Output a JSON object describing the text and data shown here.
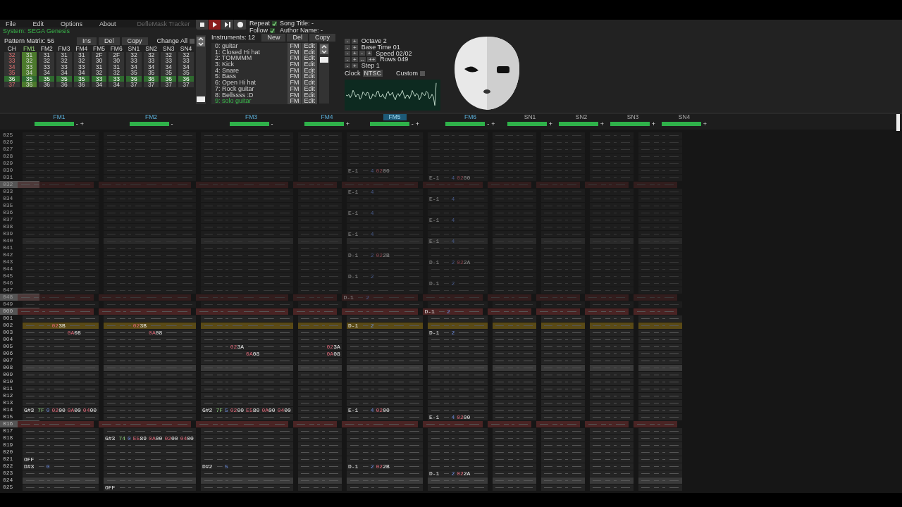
{
  "menu": [
    "File",
    "Edit",
    "Options",
    "About"
  ],
  "app_title": "DefleMask Tracker",
  "transport": [
    {
      "kind": "stop",
      "active": false
    },
    {
      "kind": "play",
      "active": true
    },
    {
      "kind": "step",
      "active": false
    },
    {
      "kind": "record",
      "active": false
    }
  ],
  "toggles": [
    {
      "label": "Repeat",
      "checked": true
    },
    {
      "label": "Follow",
      "checked": true
    }
  ],
  "song": {
    "title": "Song Title: -",
    "author": "Author Name: -"
  },
  "system": "System: SEGA Genesis",
  "pattern_matrix": {
    "label": "Pattern Matrix: 56",
    "buttons": [
      "Ins",
      "Del",
      "Copy"
    ],
    "change_all": {
      "label": "Change All",
      "checked": false
    },
    "columns": [
      {
        "label": "CH",
        "selected": false
      },
      {
        "label": "FM1",
        "selected": true
      },
      {
        "label": "FM2",
        "selected": false
      },
      {
        "label": "FM3",
        "selected": false
      },
      {
        "label": "FM4",
        "selected": false
      },
      {
        "label": "FM5",
        "selected": false
      },
      {
        "label": "FM6",
        "selected": false
      },
      {
        "label": "SN1",
        "selected": false
      },
      {
        "label": "SN2",
        "selected": false
      },
      {
        "label": "SN3",
        "selected": false
      },
      {
        "label": "SN4",
        "selected": false
      }
    ],
    "rows": [
      {
        "selected": false,
        "cells": [
          "32",
          "31",
          "31",
          "31",
          "31",
          "2F",
          "2F",
          "32",
          "32",
          "32",
          "32"
        ]
      },
      {
        "selected": false,
        "cells": [
          "33",
          "32",
          "32",
          "32",
          "32",
          "30",
          "30",
          "33",
          "33",
          "33",
          "33"
        ]
      },
      {
        "selected": false,
        "cells": [
          "34",
          "33",
          "33",
          "33",
          "33",
          "31",
          "31",
          "34",
          "34",
          "34",
          "34"
        ]
      },
      {
        "selected": false,
        "cells": [
          "35",
          "34",
          "34",
          "34",
          "34",
          "32",
          "32",
          "35",
          "35",
          "35",
          "35"
        ]
      },
      {
        "selected": true,
        "cells": [
          "36",
          "35",
          "35",
          "35",
          "35",
          "33",
          "33",
          "36",
          "36",
          "36",
          "36"
        ]
      },
      {
        "selected": false,
        "cells": [
          "37",
          "36",
          "36",
          "36",
          "36",
          "34",
          "34",
          "37",
          "37",
          "37",
          "37"
        ]
      }
    ]
  },
  "instruments": {
    "label": "Instruments: 12",
    "buttons": [
      "New",
      "Del",
      "Copy"
    ],
    "items": [
      {
        "name": "0: guitar",
        "type": "FM",
        "edit": "Edit",
        "selected": false
      },
      {
        "name": "1: Closed Hi hat",
        "type": "FM",
        "edit": "Edit",
        "selected": false
      },
      {
        "name": "2: TOMMMM",
        "type": "FM",
        "edit": "Edit",
        "selected": false
      },
      {
        "name": "3: Kick",
        "type": "FM",
        "edit": "Edit",
        "selected": false
      },
      {
        "name": "4: Snare",
        "type": "FM",
        "edit": "Edit",
        "selected": false
      },
      {
        "name": "5: Bass",
        "type": "FM",
        "edit": "Edit",
        "selected": false
      },
      {
        "name": "6: Open Hi hat",
        "type": "FM",
        "edit": "Edit",
        "selected": false
      },
      {
        "name": "7: Rock guitar",
        "type": "FM",
        "edit": "Edit",
        "selected": false
      },
      {
        "name": "8: Bellssss :D",
        "type": "FM",
        "edit": "Edit",
        "selected": false
      },
      {
        "name": "9: solo guitar",
        "type": "FM",
        "edit": "Edit",
        "selected": true
      }
    ]
  },
  "settings": [
    {
      "label": "Octave 2",
      "buttons": [
        "-",
        "+"
      ]
    },
    {
      "label": "Base Time 01",
      "buttons": [
        "-",
        "+"
      ]
    },
    {
      "label": "Speed 02/02",
      "buttons": [
        "-",
        "+",
        "-",
        "+"
      ]
    },
    {
      "label": "Rows 049",
      "buttons": [
        "-",
        "+",
        "--",
        "++"
      ]
    },
    {
      "label": "Step 1",
      "buttons": [
        "-",
        "+"
      ]
    }
  ],
  "clock": {
    "label": "Clock",
    "value": "NTSC",
    "custom": {
      "label": "Custom",
      "checked": false
    }
  },
  "channels": [
    {
      "name": "FM1",
      "kind": "fm",
      "selected": false,
      "enabled": true,
      "controls": [
        "-",
        "+"
      ]
    },
    {
      "name": "FM2",
      "kind": "fm",
      "selected": false,
      "enabled": true,
      "controls": [
        "-"
      ]
    },
    {
      "name": "FM3",
      "kind": "fm",
      "selected": false,
      "enabled": true,
      "controls": [
        "-"
      ]
    },
    {
      "name": "FM4",
      "kind": "fm",
      "selected": false,
      "enabled": true,
      "controls": [
        "+"
      ]
    },
    {
      "name": "FM5",
      "kind": "fm",
      "selected": true,
      "enabled": true,
      "controls": [
        "-",
        "+"
      ]
    },
    {
      "name": "FM6",
      "kind": "fm",
      "selected": false,
      "enabled": true,
      "controls": [
        "-",
        "+"
      ]
    },
    {
      "name": "SN1",
      "kind": "sn",
      "selected": false,
      "enabled": true,
      "controls": [
        "+"
      ]
    },
    {
      "name": "SN2",
      "kind": "sn",
      "selected": false,
      "enabled": true,
      "controls": [
        "+"
      ]
    },
    {
      "name": "SN3",
      "kind": "sn",
      "selected": false,
      "enabled": true,
      "controls": [
        "+"
      ]
    },
    {
      "name": "SN4",
      "kind": "sn",
      "selected": false,
      "enabled": true,
      "controls": [
        "+"
      ]
    }
  ],
  "pattern_rows": [
    {
      "number": "025",
      "dimmed": true,
      "kind": "plain"
    },
    {
      "number": "026",
      "dimmed": true,
      "kind": "plain"
    },
    {
      "number": "027",
      "dimmed": true,
      "kind": "plain"
    },
    {
      "number": "028",
      "dimmed": true,
      "kind": "plain"
    },
    {
      "number": "029",
      "dimmed": true,
      "kind": "plain"
    },
    {
      "number": "030",
      "dimmed": true,
      "kind": "plain",
      "cells": [
        {},
        {},
        {},
        {},
        {
          "note": "E-1",
          "ins": "4",
          "fx": [
            "0200"
          ]
        }
      ]
    },
    {
      "number": "031",
      "dimmed": true,
      "kind": "plain",
      "cells": [
        {},
        {},
        {},
        {},
        {},
        {
          "note": "E-1",
          "ins": "4",
          "fx": [
            "0200"
          ]
        }
      ]
    },
    {
      "number": "032",
      "dimmed": true,
      "kind": "bar"
    },
    {
      "number": "033",
      "dimmed": true,
      "kind": "plain",
      "cells": [
        {},
        {},
        {},
        {},
        {
          "note": "E-1",
          "ins": "4"
        }
      ]
    },
    {
      "number": "034",
      "dimmed": true,
      "kind": "plain",
      "cells": [
        {},
        {},
        {},
        {},
        {},
        {
          "note": "E-1",
          "ins": "4"
        }
      ]
    },
    {
      "number": "035",
      "dimmed": true,
      "kind": "plain"
    },
    {
      "number": "036",
      "dimmed": true,
      "kind": "plain",
      "cells": [
        {},
        {},
        {},
        {},
        {
          "note": "E-1",
          "ins": "4"
        }
      ]
    },
    {
      "number": "037",
      "dimmed": true,
      "kind": "plain",
      "cells": [
        {},
        {},
        {},
        {},
        {},
        {
          "note": "E-1",
          "ins": "4"
        }
      ]
    },
    {
      "number": "038",
      "dimmed": true,
      "kind": "plain"
    },
    {
      "number": "039",
      "dimmed": true,
      "kind": "plain",
      "cells": [
        {},
        {},
        {},
        {},
        {
          "note": "E-1",
          "ins": "4"
        }
      ]
    },
    {
      "number": "040",
      "dimmed": true,
      "kind": "beat",
      "cells": [
        {},
        {},
        {},
        {},
        {},
        {
          "note": "E-1",
          "ins": "4"
        }
      ]
    },
    {
      "number": "041",
      "dimmed": true,
      "kind": "plain"
    },
    {
      "number": "042",
      "dimmed": true,
      "kind": "plain",
      "cells": [
        {},
        {},
        {},
        {},
        {
          "note": "D-1",
          "ins": "2",
          "fx": [
            "022B"
          ]
        }
      ]
    },
    {
      "number": "043",
      "dimmed": true,
      "kind": "plain",
      "cells": [
        {},
        {},
        {},
        {},
        {},
        {
          "note": "D-1",
          "ins": "2",
          "fx": [
            "022A"
          ]
        }
      ]
    },
    {
      "number": "044",
      "dimmed": true,
      "kind": "plain"
    },
    {
      "number": "045",
      "dimmed": true,
      "kind": "plain",
      "cells": [
        {},
        {},
        {},
        {},
        {
          "note": "D-1",
          "ins": "2"
        }
      ]
    },
    {
      "number": "046",
      "dimmed": true,
      "kind": "plain",
      "cells": [
        {},
        {},
        {},
        {},
        {},
        {
          "note": "D-1",
          "ins": "2"
        }
      ]
    },
    {
      "number": "047",
      "dimmed": true,
      "kind": "plain"
    },
    {
      "number": "048",
      "dimmed": true,
      "kind": "bar",
      "cells": [
        {},
        {},
        {},
        {},
        {
          "note": "D-1",
          "ins": "2"
        }
      ]
    },
    {
      "number": "049",
      "dimmed": true,
      "kind": "plain"
    },
    {
      "number": "000",
      "dimmed": false,
      "kind": "bar",
      "cells": [
        {},
        {},
        {},
        {},
        {},
        {
          "note": "D-1",
          "ins": "2"
        }
      ]
    },
    {
      "number": "001",
      "dimmed": false,
      "kind": "plain"
    },
    {
      "number": "002",
      "dimmed": false,
      "kind": "cursor",
      "cells": [
        {
          "fx": [
            "023B"
          ]
        },
        {
          "fx": [
            "023B"
          ]
        },
        {},
        {},
        {
          "note": "D-1",
          "ins": "2"
        }
      ]
    },
    {
      "number": "003",
      "dimmed": false,
      "kind": "plain",
      "cells": [
        {
          "fx_2": "0A08"
        },
        {
          "fx_2": "0A08"
        },
        {},
        {},
        {},
        {
          "note": "D-1",
          "ins": "2"
        }
      ]
    },
    {
      "number": "004",
      "dimmed": false,
      "kind": "plain"
    },
    {
      "number": "005",
      "dimmed": false,
      "kind": "plain",
      "cells": [
        {},
        {},
        {
          "fx": [
            "023A"
          ]
        },
        {
          "fx": [
            "023A"
          ]
        }
      ]
    },
    {
      "number": "006",
      "dimmed": false,
      "kind": "plain",
      "cells": [
        {},
        {},
        {
          "fx_2": "0A08"
        },
        {
          "fx": [
            "0A08"
          ]
        }
      ]
    },
    {
      "number": "007",
      "dimmed": false,
      "kind": "plain"
    },
    {
      "number": "008",
      "dimmed": false,
      "kind": "beat"
    },
    {
      "number": "009",
      "dimmed": false,
      "kind": "plain"
    },
    {
      "number": "010",
      "dimmed": false,
      "kind": "plain"
    },
    {
      "number": "011",
      "dimmed": false,
      "kind": "plain"
    },
    {
      "number": "012",
      "dimmed": false,
      "kind": "plain"
    },
    {
      "number": "013",
      "dimmed": false,
      "kind": "plain"
    },
    {
      "number": "014",
      "dimmed": false,
      "kind": "plain",
      "cells": [
        {
          "note": "G#3",
          "vol": "7F",
          "ins": "0",
          "fx": [
            "0200",
            "0A00",
            "0400"
          ]
        },
        {},
        {
          "note": "G#2",
          "vol": "7F",
          "ins": "5",
          "fx": [
            "0200",
            "E580",
            "0A00",
            "0400"
          ]
        },
        {},
        {
          "note": "E-1",
          "ins": "4",
          "fx": [
            "0200"
          ]
        }
      ]
    },
    {
      "number": "015",
      "dimmed": false,
      "kind": "plain",
      "cells": [
        {},
        {},
        {},
        {},
        {},
        {
          "note": "E-1",
          "ins": "4",
          "fx": [
            "0200"
          ]
        }
      ]
    },
    {
      "number": "016",
      "dimmed": false,
      "kind": "bar"
    },
    {
      "number": "017",
      "dimmed": false,
      "kind": "plain"
    },
    {
      "number": "018",
      "dimmed": false,
      "kind": "plain",
      "cells": [
        {},
        {
          "note": "G#3",
          "vol": "74",
          "ins": "0",
          "fx": [
            "E589",
            "0A00",
            "0200",
            "0400"
          ]
        }
      ]
    },
    {
      "number": "019",
      "dimmed": false,
      "kind": "plain"
    },
    {
      "number": "020",
      "dimmed": false,
      "kind": "plain"
    },
    {
      "number": "021",
      "dimmed": false,
      "kind": "plain",
      "cells": [
        {
          "note": "OFF"
        }
      ]
    },
    {
      "number": "022",
      "dimmed": false,
      "kind": "plain",
      "cells": [
        {
          "note": "D#3",
          "ins": "0"
        },
        {},
        {
          "note": "D#2",
          "ins": "5"
        },
        {},
        {
          "note": "D-1",
          "ins": "2",
          "fx": [
            "022B"
          ]
        }
      ]
    },
    {
      "number": "023",
      "dimmed": false,
      "kind": "plain",
      "cells": [
        {},
        {},
        {},
        {},
        {},
        {
          "note": "D-1",
          "ins": "2",
          "fx": [
            "022A"
          ]
        }
      ]
    },
    {
      "number": "024",
      "dimmed": false,
      "kind": "beat"
    },
    {
      "number": "025",
      "dimmed": false,
      "kind": "plain",
      "cells": [
        {},
        {
          "note": "OFF"
        }
      ]
    }
  ]
}
